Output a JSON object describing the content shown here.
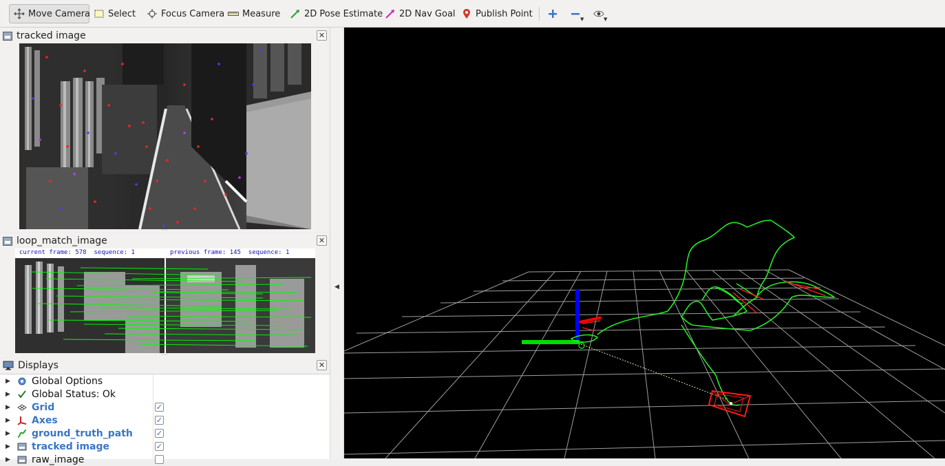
{
  "toolbar": {
    "move_camera": "Move Camera",
    "select": "Select",
    "focus_camera": "Focus Camera",
    "measure": "Measure",
    "pose_estimate": "2D Pose Estimate",
    "nav_goal": "2D Nav Goal",
    "publish_point": "Publish Point"
  },
  "panels": {
    "tracked": {
      "title": "tracked image"
    },
    "loop": {
      "title": "loop_match_image",
      "current_frame": "current frame: 578  sequence: 1",
      "previous_frame": "previous frame: 145  sequence: 1"
    },
    "displays": {
      "title": "Displays"
    }
  },
  "displays": {
    "items": [
      {
        "label": "Global Options",
        "checked": null
      },
      {
        "label": "Global Status: Ok",
        "checked": null
      },
      {
        "label": "Grid",
        "checked": true
      },
      {
        "label": "Axes",
        "checked": true
      },
      {
        "label": "ground_truth_path",
        "checked": true
      },
      {
        "label": "tracked image",
        "checked": true
      },
      {
        "label": "raw_image",
        "checked": false
      }
    ]
  },
  "colors": {
    "accent_blue": "#3a76c4",
    "path_green": "#00ff00",
    "axis_red": "#ff0000",
    "axis_blue": "#0000ff",
    "grid": "#a0a0a0"
  },
  "close_glyph": "✕",
  "check_glyph": "✓"
}
